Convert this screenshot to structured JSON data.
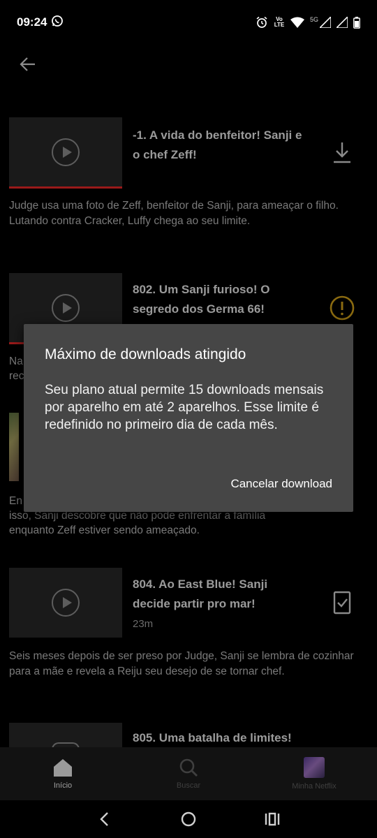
{
  "status_bar": {
    "time": "09:24",
    "network": "5G",
    "volte": "Vo LTE"
  },
  "episodes": [
    {
      "title": "-1. A vida do benfeitor! Sanji e o chef Zeff!",
      "duration": "",
      "description": "Judge usa uma foto de Zeff, benfeitor de Sanji, para ameaçar o filho. Lutando contra Cracker, Luffy chega ao seu limite.",
      "action_icon": "download-icon",
      "watch_progress": 1.0
    },
    {
      "title": "802. Um Sanji furioso! O segredo dos Germa 66!",
      "duration": "",
      "description_partial_a": "Na",
      "description_partial_b": "rec",
      "action_icon": "alert-circle-icon",
      "watch_progress": 1.0
    },
    {
      "title": "",
      "duration": "",
      "description_partial_a": "En",
      "description_partial_b": "isso, Sanji descobre que não pode enfrentar a família",
      "description_partial_c": "enquanto Zeff estiver sendo ameaçado."
    },
    {
      "title": "804. Ao East Blue! Sanji decide partir pro mar!",
      "duration": "23m",
      "description": "Seis meses depois de ser preso por Judge, Sanji se lembra de cozinhar para a mãe e revela a Reiju seu desejo de se tornar chef.",
      "action_icon": "downloaded-check-icon"
    },
    {
      "title": "805. Uma batalha de limites!",
      "duration": ""
    }
  ],
  "dialog": {
    "title": "Máximo de downloads atingido",
    "body": "Seu plano atual permite 15 downloads mensais por aparelho em até 2 aparelhos. Esse limite é redefinido no primeiro dia de cada mês.",
    "button": "Cancelar download"
  },
  "bottom_nav": {
    "items": [
      {
        "label": "Início",
        "icon": "home-icon",
        "active": true
      },
      {
        "label": "Buscar",
        "icon": "search-icon",
        "active": false
      },
      {
        "label": "Minha Netflix",
        "icon": "avatar",
        "active": false
      }
    ]
  },
  "colors": {
    "background": "#000000",
    "dialog": "#464646",
    "progress_red": "#9a1a1a",
    "alert_yellow": "#8a6a10"
  }
}
